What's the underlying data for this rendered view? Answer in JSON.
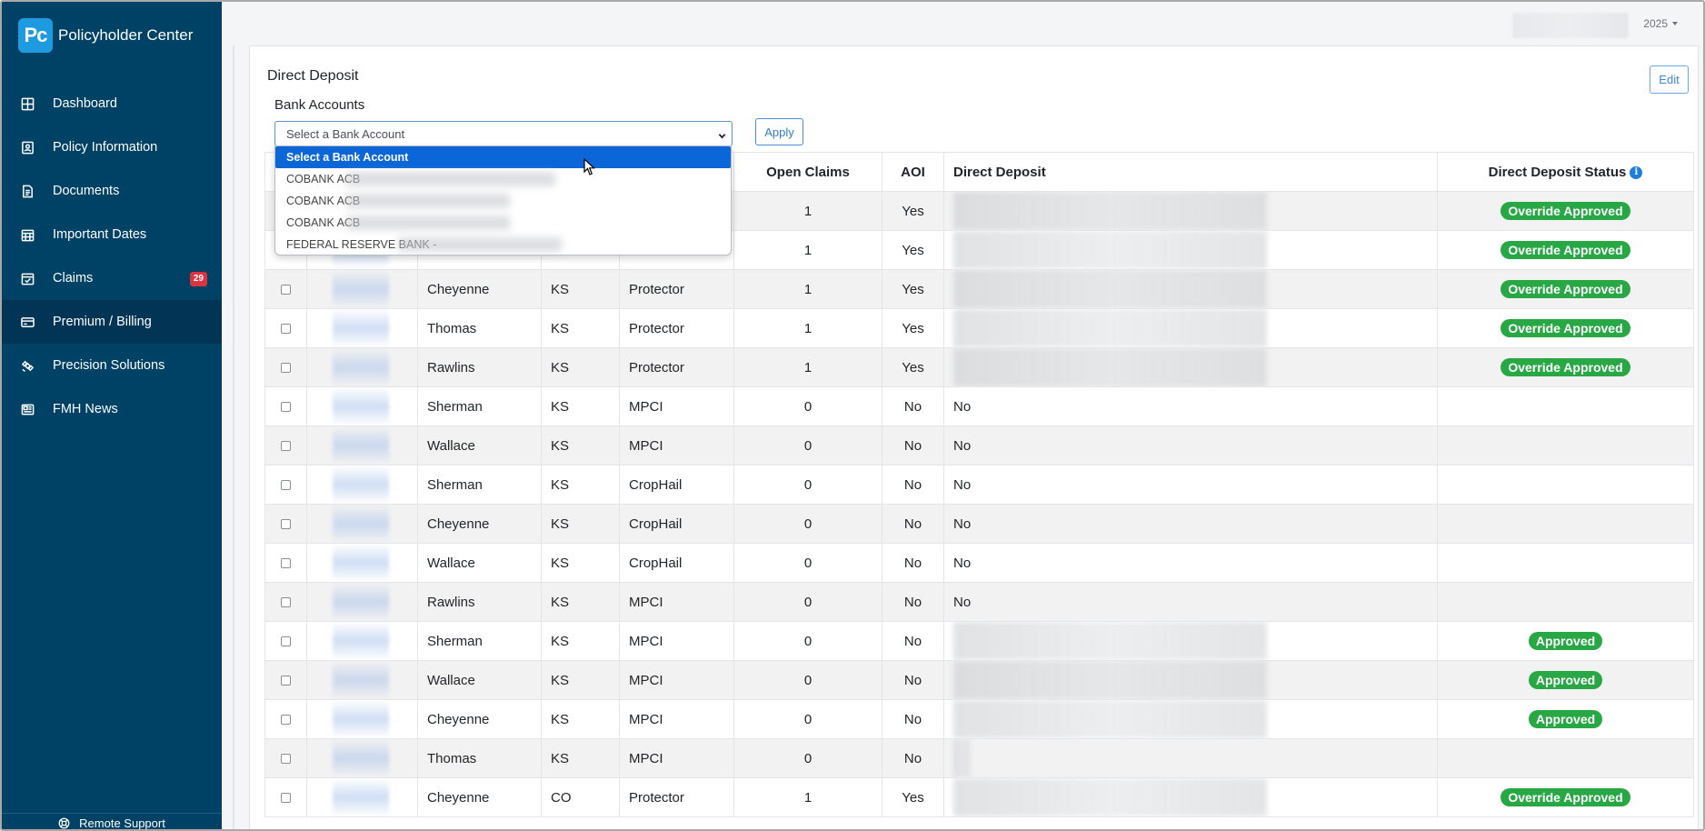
{
  "brand": {
    "logo": "Pc",
    "title": "Policyholder Center"
  },
  "nav": [
    {
      "label": "Dashboard",
      "icon": "grid-icon"
    },
    {
      "label": "Policy Information",
      "icon": "id-card-icon"
    },
    {
      "label": "Documents",
      "icon": "document-icon"
    },
    {
      "label": "Important Dates",
      "icon": "calendar-grid-icon"
    },
    {
      "label": "Claims",
      "icon": "calendar-check-icon",
      "badge": "29"
    },
    {
      "label": "Premium / Billing",
      "icon": "credit-card-icon",
      "active": true
    },
    {
      "label": "Precision Solutions",
      "icon": "satellite-icon"
    },
    {
      "label": "FMH News",
      "icon": "newspaper-icon"
    }
  ],
  "remote_support": "Remote Support",
  "topbar": {
    "year": "2025"
  },
  "section": {
    "title": "Direct Deposit",
    "edit_label": "Edit",
    "bank_label": "Bank Accounts",
    "select_value": "Select a Bank Account",
    "apply_label": "Apply"
  },
  "dropdown_options": [
    "Select a Bank Account",
    "COBANK ACB",
    "COBANK ACB",
    "COBANK ACB",
    "FEDERAL RESERVE BANK -"
  ],
  "table": {
    "headers": {
      "open_claims": "Open Claims",
      "aoi": "AOI",
      "direct_deposit": "Direct Deposit",
      "status": "Direct Deposit Status"
    },
    "rows": [
      {
        "county": "",
        "state": "",
        "plan": "",
        "open": "1",
        "aoi": "Yes",
        "dd": "",
        "status": "Override Approved"
      },
      {
        "county": "",
        "state": "",
        "plan": "",
        "open": "1",
        "aoi": "Yes",
        "dd": "",
        "status": "Override Approved"
      },
      {
        "county": "Cheyenne",
        "state": "KS",
        "plan": "Protector",
        "open": "1",
        "aoi": "Yes",
        "dd": "",
        "status": "Override Approved"
      },
      {
        "county": "Thomas",
        "state": "KS",
        "plan": "Protector",
        "open": "1",
        "aoi": "Yes",
        "dd": "",
        "status": "Override Approved"
      },
      {
        "county": "Rawlins",
        "state": "KS",
        "plan": "Protector",
        "open": "1",
        "aoi": "Yes",
        "dd": "",
        "status": "Override Approved"
      },
      {
        "county": "Sherman",
        "state": "KS",
        "plan": "MPCI",
        "open": "0",
        "aoi": "No",
        "dd": "No",
        "status": ""
      },
      {
        "county": "Wallace",
        "state": "KS",
        "plan": "MPCI",
        "open": "0",
        "aoi": "No",
        "dd": "No",
        "status": ""
      },
      {
        "county": "Sherman",
        "state": "KS",
        "plan": "CropHail",
        "open": "0",
        "aoi": "No",
        "dd": "No",
        "status": ""
      },
      {
        "county": "Cheyenne",
        "state": "KS",
        "plan": "CropHail",
        "open": "0",
        "aoi": "No",
        "dd": "No",
        "status": ""
      },
      {
        "county": "Wallace",
        "state": "KS",
        "plan": "CropHail",
        "open": "0",
        "aoi": "No",
        "dd": "No",
        "status": ""
      },
      {
        "county": "Rawlins",
        "state": "KS",
        "plan": "MPCI",
        "open": "0",
        "aoi": "No",
        "dd": "No",
        "status": ""
      },
      {
        "county": "Sherman",
        "state": "KS",
        "plan": "MPCI",
        "open": "0",
        "aoi": "No",
        "dd": "",
        "status": "Approved"
      },
      {
        "county": "Wallace",
        "state": "KS",
        "plan": "MPCI",
        "open": "0",
        "aoi": "No",
        "dd": "",
        "status": "Approved"
      },
      {
        "county": "Cheyenne",
        "state": "KS",
        "plan": "MPCI",
        "open": "0",
        "aoi": "No",
        "dd": "",
        "status": "Approved"
      },
      {
        "county": "Thomas",
        "state": "KS",
        "plan": "MPCI",
        "open": "0",
        "aoi": "No",
        "dd": "",
        "status": ""
      },
      {
        "county": "Cheyenne",
        "state": "CO",
        "plan": "Protector",
        "open": "1",
        "aoi": "Yes",
        "dd": "",
        "status": "Override Approved"
      }
    ]
  },
  "colors": {
    "sidebar": "#004166",
    "accent": "#1e9ae0",
    "approved": "#28a745",
    "badge": "#d9343f"
  }
}
